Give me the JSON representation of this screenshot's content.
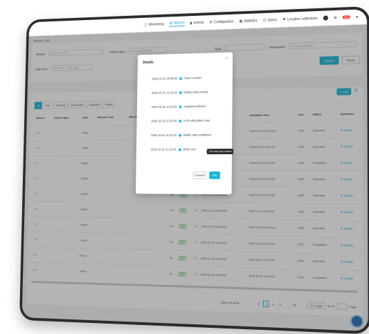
{
  "nav": {
    "items": [
      {
        "icon": "monitor-icon",
        "label": "Monitoring",
        "active": false
      },
      {
        "icon": "mission-icon",
        "label": "Mission",
        "active": true
      },
      {
        "icon": "vehicle-icon",
        "label": "Vehicle",
        "active": false
      },
      {
        "icon": "configuration-icon",
        "label": "Configuration",
        "active": false
      },
      {
        "icon": "statistics-icon",
        "label": "Statistics",
        "active": false
      },
      {
        "icon": "query-icon",
        "label": "Query",
        "active": false
      },
      {
        "icon": "location-icon",
        "label": "Location calibration",
        "active": false
      }
    ],
    "badge": "99+"
  },
  "breadcrumb": "Mission / List",
  "filters": {
    "vehicle_label": "Vehicle:",
    "vehicle_placeholder": "Select Vehicle",
    "vehicle_type_label": "Vehicle type:",
    "vehicle_type_placeholder": "Select Vehicle type",
    "type_label": "Type:",
    "destination_label": "Destination:",
    "destination_placeholder": "Select Destination",
    "start_time_label": "Start time:",
    "start_date_placeholder": "Start Date",
    "end_date_placeholder": "→ End Date",
    "search_label": "Search",
    "reset_label": "Reset"
  },
  "list": {
    "add_label": "+ Add",
    "tabs": [
      "All",
      "Free",
      "Running",
      "Completed",
      "Canceled",
      "Pause"
    ],
    "columns": [
      "Vehicle",
      "Vehicle type",
      "Type",
      "Mission code",
      "Mission trajectory",
      "",
      "",
      "",
      "",
      "Activation time",
      "Curr",
      "Status",
      "Operation"
    ],
    "rows": [
      {
        "vehicle": "5",
        "type": "Carry",
        "vio": "",
        "c7": "",
        "created": "",
        "activation": "2025-10-22 10:06:28",
        "curr": "2021",
        "status": "Canceled",
        "op": "Details"
      },
      {
        "vehicle": "4",
        "type": "Home",
        "vio": "",
        "c7": "",
        "created": "",
        "activation": "2025-10-31 11:22:24",
        "curr": "2021",
        "status": "Canceled",
        "op": "Details"
      },
      {
        "vehicle": "1",
        "type": "Home",
        "vio": "",
        "c7": "",
        "created": "",
        "activation": "2025-10-31 11:22:25",
        "curr": "2021",
        "status": "Completed",
        "op": "Details"
      },
      {
        "vehicle": "3",
        "type": "Home",
        "vio": "",
        "c7": "",
        "created": "",
        "activation": "2025-10-31 11:22:26",
        "curr": "2021",
        "status": "Canceled",
        "op": "Details"
      },
      {
        "vehicle": "4",
        "type": "Home",
        "col6": "No",
        "vio": "No",
        "c7": "0",
        "created": "2026-01-31 18:39:05",
        "activation": "2025-10-31 11:22:52",
        "curr": "2021",
        "status": "Canceled",
        "op": "Details"
      },
      {
        "vehicle": "4",
        "type": "Home",
        "col6": "No",
        "vio": "No",
        "c7": "0",
        "created": "2026-01-31 18:39:05",
        "activation": "2025-10-31 15:43:11",
        "curr": "2021",
        "status": "Canceled",
        "op": "Details"
      },
      {
        "vehicle": "4",
        "type": "Home",
        "col6": "No",
        "vio": "No",
        "c7": "0",
        "created": "2026-01-31 18:39:05",
        "activation": "2025-10-31 15:43:13",
        "curr": "2021",
        "status": "Canceled",
        "op": "Details"
      },
      {
        "vehicle": "4",
        "type": "Home",
        "col6": "No",
        "vio": "No",
        "c7": "0",
        "created": "2026-01-31 18:39:05",
        "activation": "2025-10-31 15:43:15",
        "curr": "2021",
        "status": "Completed",
        "op": "Details"
      },
      {
        "vehicle": "4",
        "type": "Home",
        "col6": "No",
        "vio": "No",
        "c7": "0",
        "created": "2026-01-31 18:39:05",
        "activation": "2025-10-31 15:43:21",
        "curr": "2021",
        "status": "Canceled",
        "op": "Details"
      },
      {
        "vehicle": "3",
        "type": "Home",
        "col6": "No",
        "vio": "No",
        "c7": "0",
        "created": "2026-01-31 18:39:05",
        "activation": "2025-10-31 15:43:23",
        "curr": "2021",
        "status": "Completed",
        "op": "Details"
      }
    ]
  },
  "pagination": {
    "total": "Total 290 items",
    "pages": [
      "1",
      "2",
      "3",
      "4",
      "5",
      "...",
      "29"
    ],
    "active_page": "3",
    "page_size": "10 / page",
    "goto_label": "Go to",
    "page_label": "Page"
  },
  "modal": {
    "title": "Details",
    "events": [
      {
        "time": "2026-01-31 18:39:05",
        "event": "Order created"
      },
      {
        "time": "2025-10-31 11:22:24",
        "event": "Mobile task created"
      },
      {
        "time": "2025-10-31 11:22:25",
        "event": "Assigned vehicles"
      },
      {
        "time": "2025-10-31 11:22:25",
        "event": "In the allocation route"
      },
      {
        "time": "2025-10-31 11:22:51",
        "event": "Mobile task completed"
      },
      {
        "time": "2025-10-31 11:22:51",
        "event": "Order end"
      }
    ],
    "tooltip": "The task has ended",
    "cancel_label": "Cancel",
    "ok_label": "OK"
  },
  "colors": {
    "accent": "#1fb5d4",
    "tooltip_bg": "#2d2d2d"
  }
}
